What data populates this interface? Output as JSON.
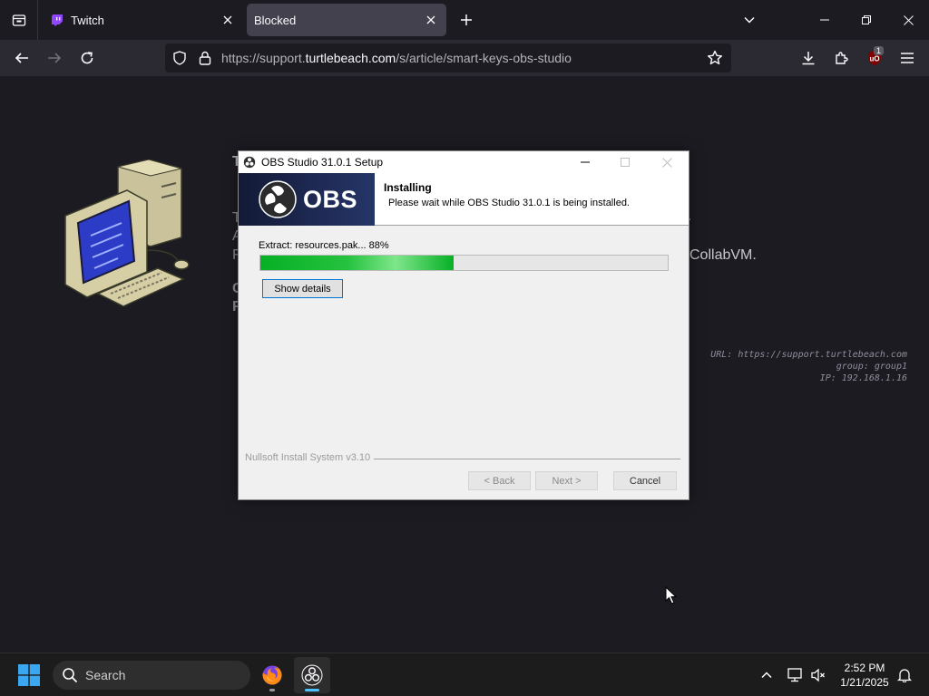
{
  "browser": {
    "tabs": [
      {
        "title": "Twitch",
        "active": false
      },
      {
        "title": "Blocked",
        "active": true
      }
    ],
    "url": {
      "prefix": "https://support.",
      "domain": "turtlebeach.com",
      "path": "/s/article/smart-keys-obs-studio"
    },
    "extensions_badge": "1"
  },
  "page": {
    "fragments": [
      "T",
      "A",
      "F",
      "C",
      "F",
      "."
    ],
    "collab_text": "CollabVM.",
    "vm_info": {
      "url_line": "URL: https://support.turtlebeach.com",
      "group_line": "group: group1",
      "ip_line": "IP: 192.168.1.16"
    }
  },
  "installer": {
    "window_title": "OBS Studio 31.0.1 Setup",
    "banner_text": "OBS",
    "header_title": "Installing",
    "header_subtitle": "Please wait while OBS Studio 31.0.1 is being installed.",
    "status_text": "Extract: resources.pak... 88%",
    "progress_fraction": 0.475,
    "show_details_label": "Show details",
    "branding": "Nullsoft Install System v3.10",
    "back_label": "< Back",
    "next_label": "Next >",
    "cancel_label": "Cancel"
  },
  "taskbar": {
    "search_label": "Search",
    "time": "2:52 PM",
    "date": "1/21/2025"
  },
  "colors": {
    "browser_bg": "#1c1b22",
    "navbar_bg": "#2b2a33",
    "progress_green": "#06b025",
    "obs_banner": "#1f2a55",
    "accent_blue": "#0078d7"
  }
}
